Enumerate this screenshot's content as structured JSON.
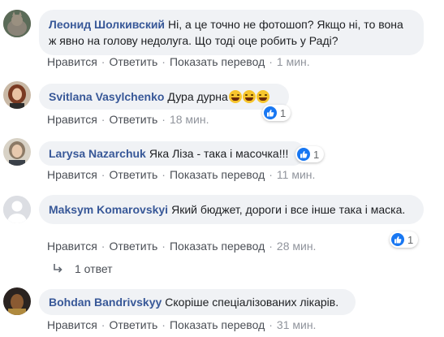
{
  "colors": {
    "author": "#385898",
    "bubble": "#f0f2f5",
    "like": "#1877f2",
    "meta": "#90949c"
  },
  "comments": [
    {
      "author": "Леонид Шолкивский",
      "text": "Ні, а це точно не фотошоп? Якщо ні, то вона ж явно на голову недолуга. Що тоді оце робить у Раді?",
      "actions": {
        "like": "Нравится",
        "reply": "Ответить",
        "translate": "Показать перевод",
        "time": "1 мин."
      }
    },
    {
      "author": "Svitlana Vasylchenko",
      "text": "Дура дурна",
      "emoji": [
        "laughing-emoji",
        "laughing-emoji",
        "laughing-emoji"
      ],
      "reaction_count": "1",
      "actions": {
        "like": "Нравится",
        "reply": "Ответить",
        "time": "18 мин."
      }
    },
    {
      "author": "Larysa Nazarchuk",
      "text": "Яка Ліза - така і масочка!!!",
      "reaction_count": "1",
      "actions": {
        "like": "Нравится",
        "reply": "Ответить",
        "translate": "Показать перевод",
        "time": "11 мин."
      }
    },
    {
      "author": "Maksym Komarovskyi",
      "text": "Який бюджет, дороги і все інше така і маска.",
      "reaction_count": "1",
      "actions": {
        "like": "Нравится",
        "reply": "Ответить",
        "translate": "Показать перевод",
        "time": "28 мин."
      },
      "replies_label": "1 ответ"
    },
    {
      "author": "Bohdan Bandrivskyy",
      "text": "Скоріше спеціалізованих лікарів.",
      "actions": {
        "like": "Нравится",
        "reply": "Ответить",
        "translate": "Показать перевод",
        "time": "31 мин."
      }
    }
  ]
}
